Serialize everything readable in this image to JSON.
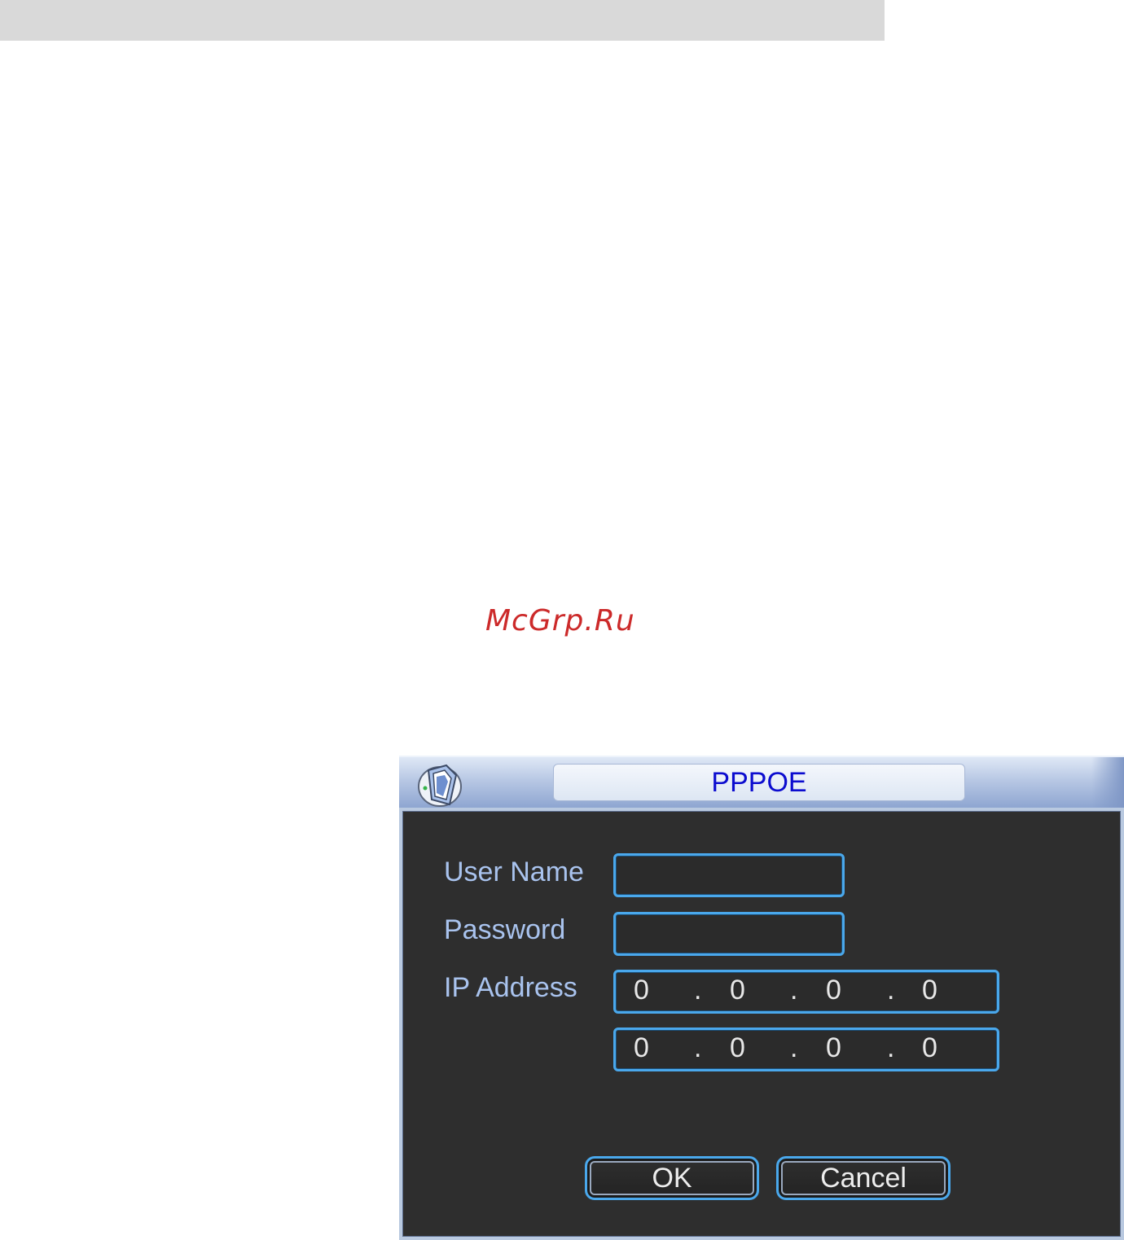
{
  "watermark": "McGrp.Ru",
  "dialog": {
    "title": "PPPOE",
    "icon": "network-cube-icon",
    "fields": {
      "user_name": {
        "label": "User Name",
        "value": ""
      },
      "password": {
        "label": "Password",
        "value": ""
      },
      "ip_address": {
        "label": "IP Address",
        "primary": [
          "0",
          "0",
          "0",
          "0"
        ],
        "secondary": [
          "0",
          "0",
          "0",
          "0"
        ],
        "separator": "."
      }
    },
    "buttons": {
      "ok": "OK",
      "cancel": "Cancel"
    }
  },
  "colors": {
    "title_text": "#0c0ccf",
    "label_text": "#a9c3ee",
    "field_border": "#4aa8ec",
    "dialog_body": "#2e2e2e"
  }
}
